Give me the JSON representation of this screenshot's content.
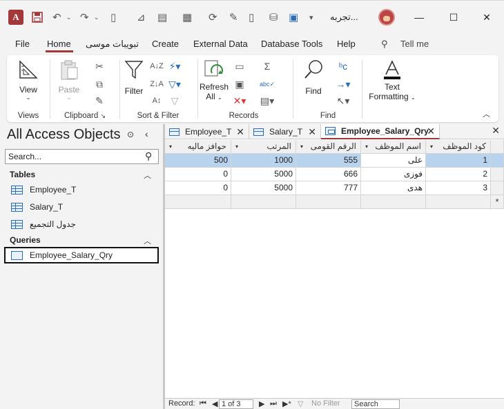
{
  "titlebar": {
    "document_title": "تجربه...",
    "app_logo_letter": "A",
    "quick_access": [
      "save-icon",
      "undo-icon",
      "redo-icon",
      "print-preview-icon",
      "view-icon",
      "form-icon",
      "report-icon",
      "refresh-icon",
      "format-painter-icon",
      "document-icon",
      "database-icon",
      "team-icon",
      "customize-icon"
    ]
  },
  "menu": {
    "tabs": [
      "File",
      "Home",
      "تبويبات موسى",
      "Create",
      "External Data",
      "Database Tools",
      "Help"
    ],
    "active_tab": "Home",
    "tell_me": "Tell me"
  },
  "ribbon": {
    "groups": {
      "views": {
        "label": "Views",
        "view_button": "View"
      },
      "clipboard": {
        "label": "Clipboard",
        "paste_button": "Paste"
      },
      "sort_filter": {
        "label": "Sort & Filter",
        "filter_button": "Filter"
      },
      "records": {
        "label": "Records",
        "refresh_button": "Refresh",
        "refresh_sub": "All"
      },
      "find": {
        "label": "Find",
        "find_button": "Find"
      },
      "text_formatting": {
        "line1": "Text",
        "line2": "Formatting"
      }
    }
  },
  "nav_pane": {
    "title": "All Access Objects",
    "search_placeholder": "Search...",
    "sections": {
      "tables": {
        "label": "Tables",
        "items": [
          "Employee_T",
          "Salary_T",
          "جدول التجميع"
        ]
      },
      "queries": {
        "label": "Queries",
        "items": [
          "Employee_Salary_Qry"
        ]
      }
    }
  },
  "doc_tabs": [
    {
      "label": "Employee_T",
      "type": "table"
    },
    {
      "label": "Salary_T",
      "type": "table"
    },
    {
      "label": "Employee_Salary_Qry",
      "type": "query",
      "active": true
    }
  ],
  "grid": {
    "columns": [
      "كود الموظف",
      "اسم الموظف",
      "الرقم القومى",
      "المرتب",
      "حوافز ماليه"
    ],
    "rows": [
      {
        "code": "1",
        "name": "على",
        "national_id": "555",
        "salary": "1000",
        "bonus": "500",
        "selected": true
      },
      {
        "code": "2",
        "name": "فوزى",
        "national_id": "666",
        "salary": "5000",
        "bonus": "0"
      },
      {
        "code": "3",
        "name": "هدى",
        "national_id": "777",
        "salary": "5000",
        "bonus": "0"
      }
    ],
    "new_row_marker": "*"
  },
  "record_nav": {
    "label": "Record:",
    "current": "1 of 3",
    "filter_status": "No Filter",
    "search_placeholder": "Search"
  }
}
